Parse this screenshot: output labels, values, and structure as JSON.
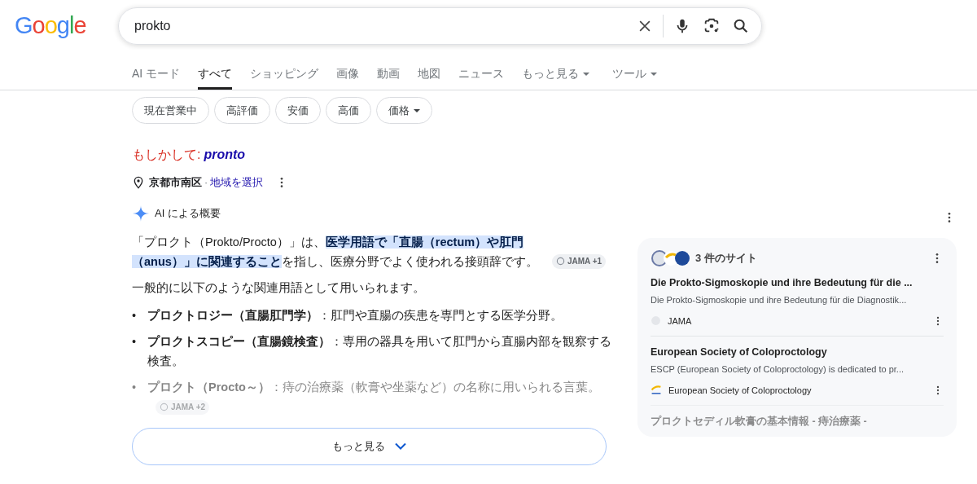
{
  "logo": "Google",
  "search": {
    "value": "prokto"
  },
  "tabs": [
    {
      "label": "AI モード",
      "selected": false,
      "dropdown": false
    },
    {
      "label": "すべて",
      "selected": true,
      "dropdown": false
    },
    {
      "label": "ショッピング",
      "selected": false,
      "dropdown": false
    },
    {
      "label": "画像",
      "selected": false,
      "dropdown": false
    },
    {
      "label": "動画",
      "selected": false,
      "dropdown": false
    },
    {
      "label": "地図",
      "selected": false,
      "dropdown": false
    },
    {
      "label": "ニュース",
      "selected": false,
      "dropdown": false
    },
    {
      "label": "もっと見る",
      "selected": false,
      "dropdown": true
    },
    {
      "label": "ツール",
      "selected": false,
      "dropdown": true
    }
  ],
  "chips": [
    {
      "label": "現在営業中",
      "dropdown": false
    },
    {
      "label": "高評価",
      "dropdown": false
    },
    {
      "label": "安価",
      "dropdown": false
    },
    {
      "label": "高価",
      "dropdown": false
    },
    {
      "label": "価格",
      "dropdown": true
    }
  ],
  "did_you_mean": {
    "prefix": "もしかして:",
    "suggestion": "pronto"
  },
  "location": {
    "place": "京都市南区",
    "separator": "·",
    "link": "地域を選択"
  },
  "ai_overview": {
    "title": "AI による概要",
    "intro": "「プロクト（Prokto/Procto）」は、**医学用語で「直腸（rectum）や肛門（anus）」に関連すること**を指し、医療分野でよく使われる接頭辞です。",
    "intro_citation": "JAMA +1",
    "lead": "一般的に以下のような関連用語として用いられます。",
    "bullets": [
      {
        "bullet": "•",
        "term": "プロクトロジー（直腸肛門学）",
        "text": "：肛門や直腸の疾患を専門とする医学分野。",
        "faded": false
      },
      {
        "bullet": "•",
        "term": "プロクトスコピー（直腸鏡検査）",
        "text": "：専用の器具を用いて肛門から直腸内部を観察する検査。",
        "faded": false
      },
      {
        "bullet": "•",
        "term": "プロクト（Procto～）",
        "text": "：痔の治療薬（軟膏や坐薬など）の名称に用いられる言葉。",
        "faded": true,
        "citation": "JAMA +2"
      }
    ],
    "more_button": "もっと見る"
  },
  "sources": {
    "title": "3 件のサイト",
    "items": [
      {
        "title": "Die Prokto-Sigmoskopie und ihre Bedeutung für die ...",
        "snippet": "Die Prokto-Sigmoskopie und ihre Bedeutung für die Diagnostik...",
        "site": "JAMA",
        "faded": false
      },
      {
        "title": "European Society of Coloproctology",
        "snippet": "ESCP (European Society of Coloproctology) is dedicated to pr...",
        "site": "European Society of Coloproctology",
        "faded": false
      },
      {
        "title": "プロクトセディル軟膏の基本情報 - 痔治療薬 -",
        "faded": true
      }
    ]
  }
}
